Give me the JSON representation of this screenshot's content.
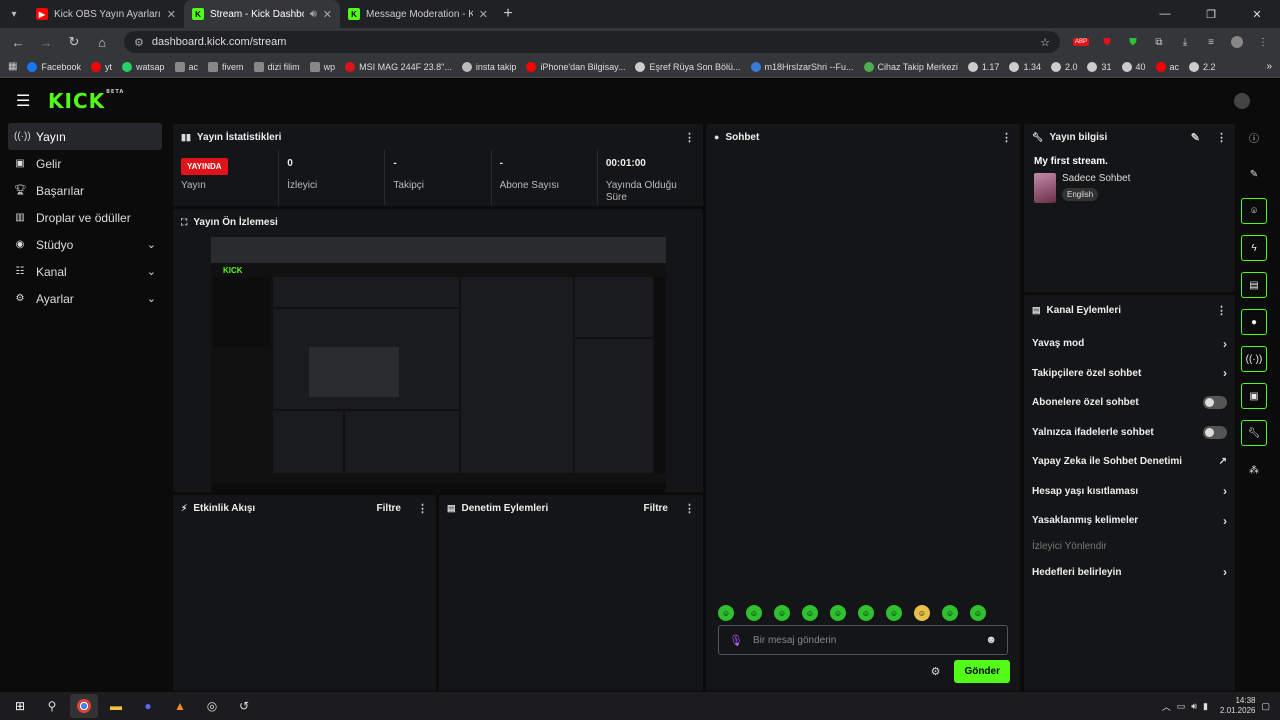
{
  "browser": {
    "tabs": [
      {
        "title": "Kick OBS Yayın Ayarları Nasıl Ya",
        "icon": "youtube-icon",
        "color": "#ff0000",
        "active": false
      },
      {
        "title": "Stream - Kick Dashboard",
        "icon": "kick-icon",
        "color": "#53fc18",
        "active": true
      },
      {
        "title": "Message Moderation - Kick Da",
        "icon": "kick-icon",
        "color": "#53fc18",
        "active": false
      }
    ],
    "url": "dashboard.kick.com/stream",
    "bookmarks": [
      "Facebook",
      "yt",
      "watsap",
      "ac",
      "fivem",
      "dizi filim",
      "wp",
      "MSI MAG 244F 23.8\"...",
      "insta takip",
      "iPhone'dan Bilgisay...",
      "Eşref Rüya Son Bölü...",
      "m18HrsIzarShri --Fu...",
      "Cihaz Takip Merkezi",
      "1.17",
      "1.34",
      "2.0",
      "31",
      "40",
      "ac",
      "2.2"
    ]
  },
  "brand": {
    "logo": "KICK",
    "badge": "BETA",
    "accent": "#53fc18"
  },
  "sidebar": {
    "items": [
      {
        "label": "Yayın",
        "icon": "broadcast-icon",
        "active": true,
        "chevron": false
      },
      {
        "label": "Gelir",
        "icon": "revenue-icon",
        "active": false,
        "chevron": false
      },
      {
        "label": "Başarılar",
        "icon": "trophy-icon",
        "active": false,
        "chevron": false
      },
      {
        "label": "Droplar ve ödüller",
        "icon": "gift-icon",
        "active": false,
        "chevron": false
      },
      {
        "label": "Stüdyo",
        "icon": "studio-icon",
        "active": false,
        "chevron": true
      },
      {
        "label": "Kanal",
        "icon": "channel-icon",
        "active": false,
        "chevron": true
      },
      {
        "label": "Ayarlar",
        "icon": "gear-icon",
        "active": false,
        "chevron": true
      }
    ]
  },
  "stats_panel": {
    "title": "Yayın İstatistikleri",
    "live_badge": "YAYINDA",
    "stats": [
      {
        "value": "",
        "label": "Yayın"
      },
      {
        "value": "0",
        "label": "İzleyici"
      },
      {
        "value": "-",
        "label": "Takipçi"
      },
      {
        "value": "-",
        "label": "Abone Sayısı"
      },
      {
        "value": "00:01:00",
        "label": "Yayında Olduğu Süre"
      }
    ]
  },
  "preview_panel": {
    "title": "Yayın Ön İzlemesi"
  },
  "activity_panel": {
    "title": "Etkinlik Akışı",
    "filter": "Filtre"
  },
  "moderation_panel": {
    "title": "Denetim Eylemleri",
    "filter": "Filtre"
  },
  "chat_panel": {
    "title": "Sohbet",
    "placeholder": "Bir mesaj gönderin",
    "send_label": "Gönder"
  },
  "stream_info": {
    "title": "Yayın bilgisi",
    "stream_title": "My first stream.",
    "category": "Sadece Sohbet",
    "language": "English"
  },
  "channel_actions": {
    "title": "Kanal Eylemleri",
    "items": [
      {
        "label": "Yavaş mod",
        "control": "chevron",
        "disabled": false
      },
      {
        "label": "Takipçilere özel sohbet",
        "control": "chevron",
        "disabled": false
      },
      {
        "label": "Abonelere özel sohbet",
        "control": "toggle",
        "disabled": false
      },
      {
        "label": "Yalnızca ifadelerle sohbet",
        "control": "toggle",
        "disabled": false
      },
      {
        "label": "Yapay Zeka ile Sohbet Denetimi",
        "control": "external",
        "disabled": false
      },
      {
        "label": "Hesap yaşı kısıtlaması",
        "control": "chevron",
        "disabled": false
      },
      {
        "label": "Yasaklanmış kelimeler",
        "control": "chevron",
        "disabled": false
      },
      {
        "label": "İzleyici Yönlendir",
        "control": "none",
        "disabled": true
      },
      {
        "label": "Hedefleri belirleyin",
        "control": "chevron",
        "disabled": false
      }
    ]
  },
  "taskbar": {
    "time": "14:38",
    "date": "2.01.2026"
  }
}
